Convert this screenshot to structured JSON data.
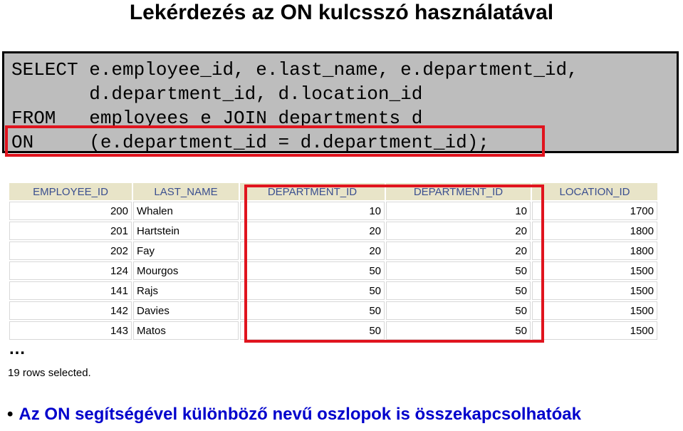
{
  "title": "Lekérdezés az ON kulcsszó használatával",
  "sql": {
    "lines": [
      "SELECT e.employee_id, e.last_name, e.department_id,",
      "       d.department_id, d.location_id",
      "FROM   employees e JOIN departments d",
      "ON     (e.department_id = d.department_id);"
    ]
  },
  "table": {
    "headers": [
      "EMPLOYEE_ID",
      "LAST_NAME",
      "DEPARTMENT_ID",
      "DEPARTMENT_ID",
      "LOCATION_ID"
    ],
    "rows": [
      [
        "200",
        "Whalen",
        "10",
        "10",
        "1700"
      ],
      [
        "201",
        "Hartstein",
        "20",
        "20",
        "1800"
      ],
      [
        "202",
        "Fay",
        "20",
        "20",
        "1800"
      ],
      [
        "124",
        "Mourgos",
        "50",
        "50",
        "1500"
      ],
      [
        "141",
        "Rajs",
        "50",
        "50",
        "1500"
      ],
      [
        "142",
        "Davies",
        "50",
        "50",
        "1500"
      ],
      [
        "143",
        "Matos",
        "50",
        "50",
        "1500"
      ]
    ]
  },
  "ellipsis": "…",
  "rows_selected": "19 rows selected.",
  "bullet_text": "Az ON segítségével különböző nevű oszlopok is összekapcsolhatóak",
  "colors": {
    "highlight": "#e0141e",
    "header_bg": "#e8e4c8",
    "header_text": "#3b4f8f",
    "bullet_text": "#0000cc",
    "sql_bg": "#bdbdbd"
  }
}
